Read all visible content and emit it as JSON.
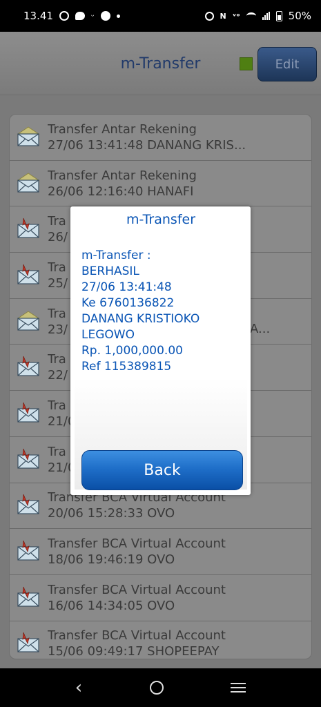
{
  "status_bar": {
    "time": "13.41",
    "battery": "50%"
  },
  "header": {
    "title": "m-Transfer",
    "edit_label": "Edit",
    "status_color": "#4f7f12"
  },
  "list": {
    "items": [
      {
        "icon": "envelope-open-icon",
        "title": "Transfer Antar Rekening",
        "subtitle": "27/06 13:41:48 DANANG KRIS..."
      },
      {
        "icon": "envelope-open-icon",
        "title": "Transfer Antar Rekening",
        "subtitle": "26/06 12:16:40 HANAFI"
      },
      {
        "icon": "envelope-alert-icon",
        "title": "Tra",
        "subtitle": "26/"
      },
      {
        "icon": "envelope-alert-icon",
        "title": "Tra",
        "subtitle": "25/"
      },
      {
        "icon": "envelope-open-icon",
        "title": "Tra",
        "subtitle": "23/"
      },
      {
        "icon": "envelope-alert-icon",
        "title": "Tra",
        "subtitle": "22/"
      },
      {
        "icon": "envelope-alert-icon",
        "title": "Tra",
        "subtitle": "21/0"
      },
      {
        "icon": "envelope-alert-icon",
        "title": "Tra",
        "subtitle": "21/0"
      },
      {
        "icon": "envelope-alert-icon",
        "title": "Transfer BCA Virtual Account",
        "subtitle": "20/06 15:28:33 OVO"
      },
      {
        "icon": "envelope-alert-icon",
        "title": "Transfer BCA Virtual Account",
        "subtitle": "18/06 19:46:19 OVO"
      },
      {
        "icon": "envelope-alert-icon",
        "title": "Transfer BCA Virtual Account",
        "subtitle": "16/06 14:34:05 OVO"
      },
      {
        "icon": "envelope-alert-icon",
        "title": "Transfer BCA Virtual Account",
        "subtitle": "15/06 09:49:17 SHOPEEPAY"
      }
    ],
    "partial_text_row5": "A..."
  },
  "modal": {
    "title": "m-Transfer",
    "lines": [
      "m-Transfer :",
      "BERHASIL",
      "27/06 13:41:48",
      "Ke 6760136822",
      "DANANG KRISTIOKO",
      "LEGOWO",
      "Rp. 1,000,000.00",
      "Ref 115389815"
    ],
    "back_label": "Back"
  },
  "nav": {
    "back_glyph": "‹"
  }
}
